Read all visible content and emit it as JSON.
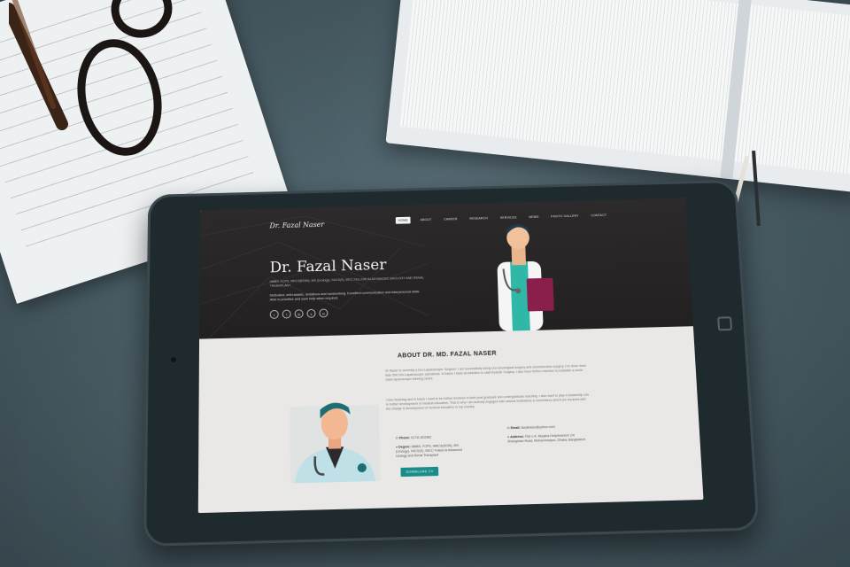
{
  "site": {
    "logo": "Dr. Fazal Naser",
    "nav": [
      "HOME",
      "ABOUT",
      "CAREER",
      "RESEARCH",
      "SERVICES",
      "NEWS",
      "PHOTO GALLERY",
      "CONTACT"
    ],
    "active_nav": "HOME",
    "hero_name": "Dr. Fazal Naser",
    "hero_subtitle": "MBBS, FCPS, MRCS(EDIN), MS (Urology), FACS(S), MCC FELLOW IN ADVANCED UROLOGY AND RENAL TRANSPLANT",
    "hero_description": "Motivated, enthusiastic, ambitious and hardworking. Excellent communication and interpersonal skills. Able to prioritize and seek help when required.",
    "socials": [
      "twitter-icon",
      "facebook-icon",
      "instagram-icon",
      "skype-icon",
      "linkedin-icon"
    ],
    "about_title": "ABOUT DR. MD. FAZAL NASER",
    "about_p1": "Dr Naser is currently a Uro-Laparoscopic Surgeon. I am successfully doing Uro-oncological surgery and reconstructive surgery. I've done more than 500 Uro-Laparoscopic operations. In future I have an intention to start Robotic Surgery. I also have further intention to establish a world class laparoscopic training centre.",
    "about_p2": "I love teaching and in future I want to be further involved in both post graduate and undergraduate teaching. I also want to play a leadership role in further development of medical education. That is why I am actively engaged with various institutions & committees which are involved with the change & development of medical education in my country.",
    "phone_label": "Phone:",
    "phone_value": "01711-822982",
    "degree_label": "Degree:",
    "degree_value": "MBBS, FCPS, MRCS(EDIN), MS (Urology), FACS(S), IMCC Fellow in Advanced Urology and Renal Transplant",
    "email_label": "Email:",
    "email_value": "fazalnaser@yahoo.com",
    "address_label": "Address:",
    "address_value": "Flat 1-A, Nurjaha Delphinarium 1/4 Shangshan Road, Mohammadpur, Dhaka, Bangladesh",
    "download_button": "DOWNLOAD CV"
  },
  "colors": {
    "accent": "#1a8c8a",
    "hero_bg": "#2c2a2b",
    "page_bg": "#e9e8e6"
  }
}
